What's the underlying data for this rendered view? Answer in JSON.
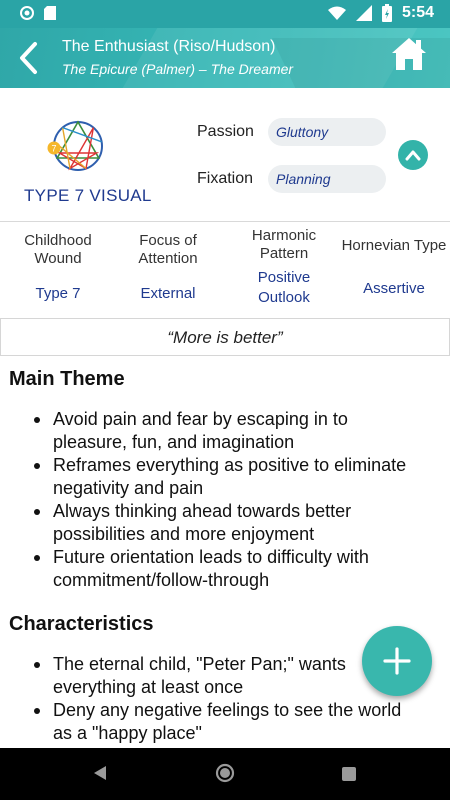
{
  "status_bar": {
    "time": "5:54"
  },
  "header": {
    "title": "The Enthusiast (Riso/Hudson)",
    "subtitle": "The Epicure (Palmer) – The Dreamer"
  },
  "type_block": {
    "symbol_number": "7",
    "visual_label": "TYPE 7 VISUAL",
    "passion": {
      "label": "Passion",
      "value": "Gluttony"
    },
    "fixation": {
      "label": "Fixation",
      "value": "Planning"
    }
  },
  "attributes": [
    {
      "heading": [
        "Childhood",
        "Wound"
      ],
      "value": [
        "Type 7"
      ]
    },
    {
      "heading": [
        "Focus of",
        "Attention"
      ],
      "value": [
        "External"
      ]
    },
    {
      "heading": [
        "Harmonic",
        "Pattern"
      ],
      "value": [
        "Positive",
        "Outlook"
      ]
    },
    {
      "heading": [
        "Hornevian Type"
      ],
      "value": [
        "Assertive"
      ]
    }
  ],
  "quote": "“More is better”",
  "sections": {
    "main_theme": {
      "title": "Main Theme",
      "items": [
        [
          "Avoid pain and fear by escaping in to",
          "pleasure, fun, and imagination"
        ],
        [
          "Reframes everything as positive to eliminate",
          "negativity and pain"
        ],
        [
          "Always thinking ahead towards better",
          "possibilities and more enjoyment"
        ],
        [
          "Future orientation leads to difficulty with",
          "commitment/follow-through"
        ]
      ]
    },
    "characteristics": {
      "title": "Characteristics",
      "items": [
        [
          "The eternal child, \"Peter Pan;\" wants",
          "everything at least once"
        ],
        [
          "Deny any negative feelings to see the world",
          "as a \"happy place\""
        ]
      ]
    }
  },
  "colors": {
    "accent_teal": "#33b3a9",
    "header_teal": "#2fa7a8",
    "value_blue": "#1f3a8f"
  }
}
